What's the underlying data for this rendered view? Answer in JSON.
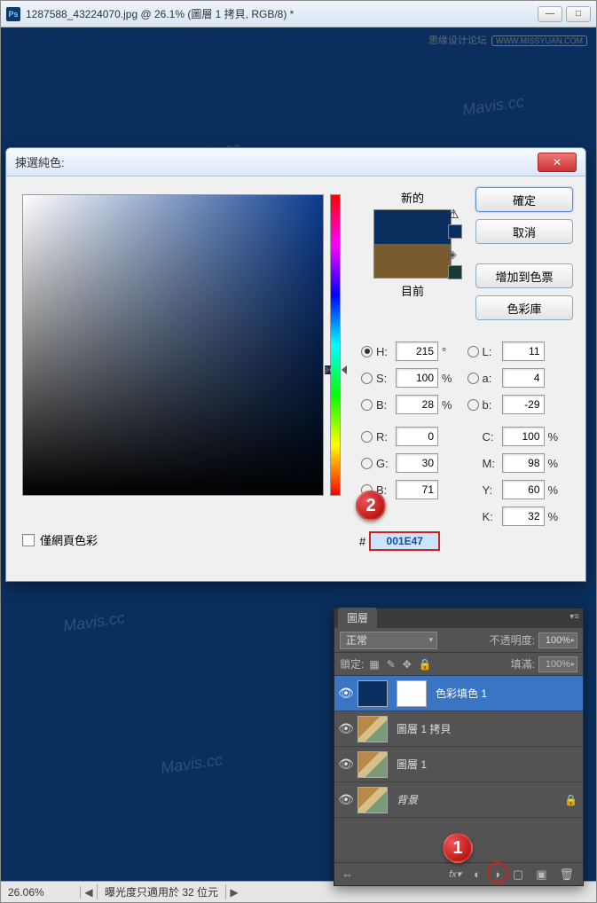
{
  "window": {
    "title": "1287588_43224070.jpg @ 26.1% (圖層 1 拷貝, RGB/8) *",
    "ps_icon_text": "Ps",
    "btn_min": "—",
    "btn_max": "□",
    "btn_close": "✕"
  },
  "site_watermark": {
    "text": "思缘设计论坛",
    "pill": "WWW.MISSYUAN.COM"
  },
  "mavis_watermark": "Mavis.cc",
  "statusbar": {
    "zoom": "26.06%",
    "arrow_l": "◀",
    "info": "曝光度只適用於 32 位元",
    "arrow_r": "▶"
  },
  "dialog": {
    "title": "揀選純色:",
    "close": "✕",
    "new_label": "新的",
    "current_label": "目前",
    "warn_icon": "⚠",
    "btn_ok": "確定",
    "btn_cancel": "取消",
    "btn_add": "增加到色票",
    "btn_lib": "色彩庫",
    "fields": {
      "H": {
        "label": "H:",
        "value": "215",
        "unit": "°"
      },
      "S": {
        "label": "S:",
        "value": "100",
        "unit": "%"
      },
      "Bv": {
        "label": "B:",
        "value": "28",
        "unit": "%"
      },
      "R": {
        "label": "R:",
        "value": "0",
        "unit": ""
      },
      "G": {
        "label": "G:",
        "value": "30",
        "unit": ""
      },
      "Bb": {
        "label": "B:",
        "value": "71",
        "unit": ""
      },
      "L": {
        "label": "L:",
        "value": "11",
        "unit": ""
      },
      "a": {
        "label": "a:",
        "value": "4",
        "unit": ""
      },
      "b": {
        "label": "b:",
        "value": "-29",
        "unit": ""
      },
      "C": {
        "label": "C:",
        "value": "100",
        "unit": "%"
      },
      "M": {
        "label": "M:",
        "value": "98",
        "unit": "%"
      },
      "Y": {
        "label": "Y:",
        "value": "60",
        "unit": "%"
      },
      "K": {
        "label": "K:",
        "value": "32",
        "unit": "%"
      }
    },
    "hex_hash": "#",
    "hex_value": "001E47",
    "web_only_label": "僅網頁色彩"
  },
  "badges": {
    "one": "1",
    "two": "2"
  },
  "layers": {
    "tab": "圖層",
    "menu_icon": "▾≡",
    "blend_mode": "正常",
    "opacity_label": "不透明度:",
    "opacity_value": "100%",
    "lock_label": "鎖定:",
    "fill_label": "填滿:",
    "fill_value": "100%",
    "lock_icons": {
      "trans": "▦",
      "brush": "✎",
      "move": "✥",
      "all": "🔒"
    },
    "rows": [
      {
        "name": "色彩填色 1",
        "eye": "👁",
        "type": "fill"
      },
      {
        "name": "圖層 1 拷貝",
        "eye": "👁",
        "type": "lion"
      },
      {
        "name": "圖層 1",
        "eye": "👁",
        "type": "lion"
      },
      {
        "name": "背景",
        "eye": "👁",
        "type": "lion",
        "locked": true,
        "italic": true
      }
    ],
    "footer": {
      "link": "⇔",
      "fx": "fx▾",
      "mask": "◐",
      "adjust": "◑",
      "folder": "▢",
      "new": "▣",
      "trash": "🗑"
    }
  }
}
